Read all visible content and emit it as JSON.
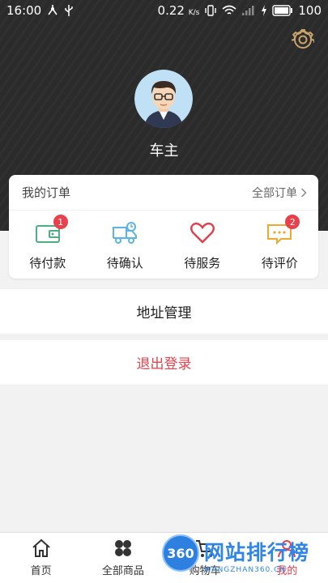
{
  "status_bar": {
    "time": "16:00",
    "speed": "0.22",
    "speed_unit": "K/s",
    "battery": "100"
  },
  "header": {
    "settings_icon": "gear-icon",
    "username": "车主"
  },
  "orders": {
    "title": "我的订单",
    "all_label": "全部订单",
    "items": [
      {
        "label": "待付款",
        "icon": "wallet-icon",
        "badge": "1",
        "color": "#4caf7f"
      },
      {
        "label": "待确认",
        "icon": "truck-icon",
        "badge": "",
        "color": "#5ab4e6"
      },
      {
        "label": "待服务",
        "icon": "heart-icon",
        "badge": "",
        "color": "#e0404a"
      },
      {
        "label": "待评价",
        "icon": "chat-icon",
        "badge": "2",
        "color": "#f0a830"
      }
    ]
  },
  "menu": {
    "address_label": "地址管理",
    "logout_label": "退出登录"
  },
  "tabbar": {
    "tabs": [
      {
        "label": "首页",
        "icon": "home-icon"
      },
      {
        "label": "全部商品",
        "icon": "grid-icon"
      },
      {
        "label": "购物车",
        "icon": "cart-icon"
      },
      {
        "label": "我的",
        "icon": "user-icon"
      }
    ]
  },
  "watermark": {
    "badge": "360",
    "title": "网站排行榜",
    "subtitle": "WANGZHAN360.CN"
  },
  "colors": {
    "accent": "#e9414b",
    "header_bg": "#2b2b2b"
  }
}
